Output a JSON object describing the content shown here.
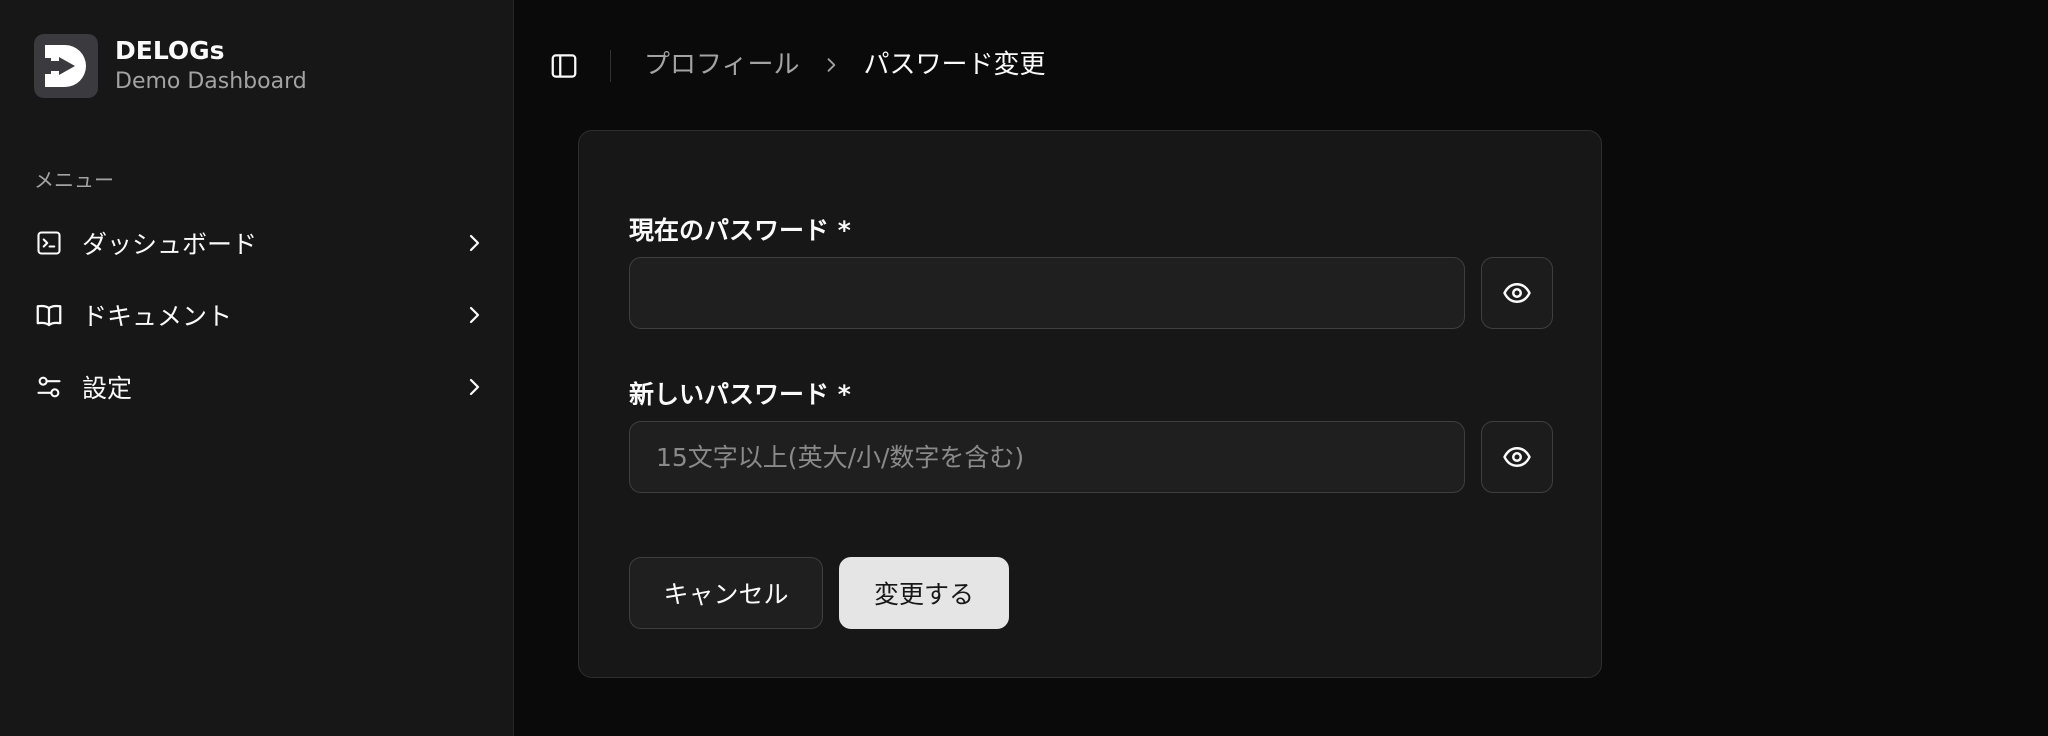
{
  "brand": {
    "name": "DELOGs",
    "subtitle": "Demo Dashboard"
  },
  "sidebar": {
    "menu_label": "メニュー",
    "items": [
      {
        "label": "ダッシュボード",
        "icon": "terminal-icon"
      },
      {
        "label": "ドキュメント",
        "icon": "book-icon"
      },
      {
        "label": "設定",
        "icon": "settings-sliders-icon"
      }
    ]
  },
  "breadcrumb": {
    "parent": "プロフィール",
    "current": "パスワード変更"
  },
  "form": {
    "current_password": {
      "label": "現在のパスワード *",
      "value": "",
      "placeholder": ""
    },
    "new_password": {
      "label": "新しいパスワード *",
      "value": "",
      "placeholder": "15文字以上(英大/小/数字を含む)"
    },
    "cancel_label": "キャンセル",
    "submit_label": "変更する"
  },
  "colors": {
    "background": "#0a0a0a",
    "sidebar": "#171717",
    "card": "#171717",
    "primary_button": "#e5e5e5"
  }
}
